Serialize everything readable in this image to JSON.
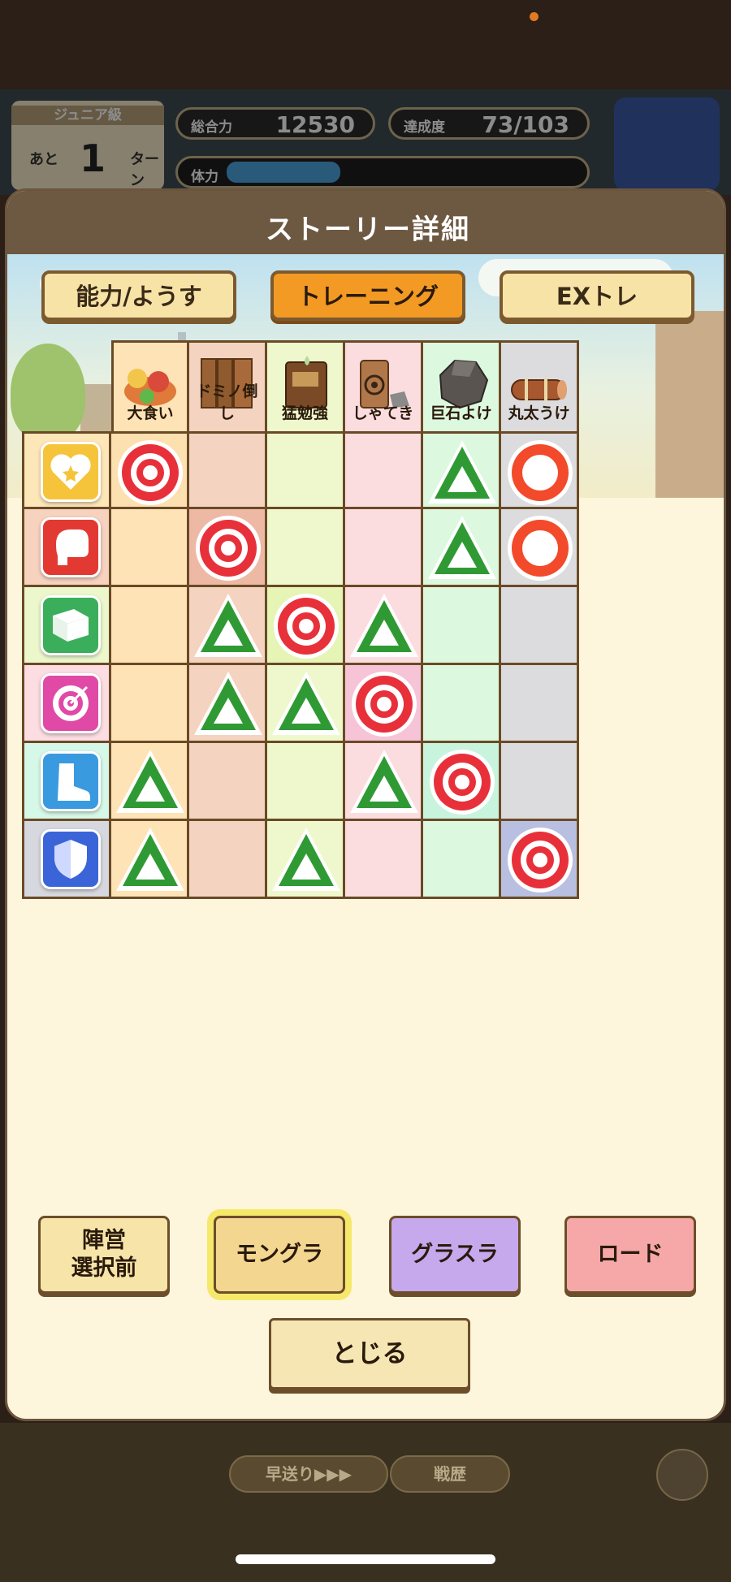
{
  "background": {
    "card": {
      "title": "ジュニア級",
      "prefix": "あと",
      "number": "1",
      "suffix": "ターン"
    },
    "total_power": {
      "label": "総合力",
      "value": "12530"
    },
    "achievement": {
      "label": "達成度",
      "value": "73/103"
    },
    "stamina": {
      "label": "体力"
    },
    "bottom_buttons": [
      "早送り▶▶▶",
      "戦歴"
    ]
  },
  "modal": {
    "title": "ストーリー詳細",
    "tabs": [
      {
        "label": "能力/ようす",
        "active": false
      },
      {
        "label": "トレーニング",
        "active": true
      },
      {
        "label": "EXトレ",
        "active": false
      }
    ],
    "columns": [
      "大食い",
      "ドミノ倒し",
      "猛勉強",
      "しゃてき",
      "巨石よけ",
      "丸太うけ"
    ],
    "rows": [
      {
        "stat": "heart-icon",
        "color": "#f5c43a",
        "marks": [
          "double",
          "",
          "",
          "",
          "triangle",
          "circle"
        ]
      },
      {
        "stat": "boxing-glove-icon",
        "color": "#e23a32",
        "marks": [
          "",
          "double",
          "",
          "",
          "triangle",
          "circle"
        ]
      },
      {
        "stat": "book-icon",
        "color": "#3aae5a",
        "marks": [
          "",
          "triangle",
          "double",
          "triangle",
          "",
          ""
        ]
      },
      {
        "stat": "target-icon",
        "color": "#e04aa6",
        "marks": [
          "",
          "triangle",
          "triangle",
          "double",
          "",
          ""
        ]
      },
      {
        "stat": "boot-icon",
        "color": "#3a9ae0",
        "marks": [
          "triangle",
          "",
          "",
          "triangle",
          "double",
          ""
        ]
      },
      {
        "stat": "shield-icon",
        "color": "#3a64d8",
        "marks": [
          "triangle",
          "",
          "triangle",
          "",
          "",
          "double"
        ]
      }
    ],
    "scenario_buttons": [
      {
        "label": "陣営\n選択前",
        "selected": false
      },
      {
        "label": "モングラ",
        "selected": true
      },
      {
        "label": "グラスラ",
        "selected": false
      },
      {
        "label": "ロード",
        "selected": false
      }
    ],
    "close_label": "とじる"
  }
}
